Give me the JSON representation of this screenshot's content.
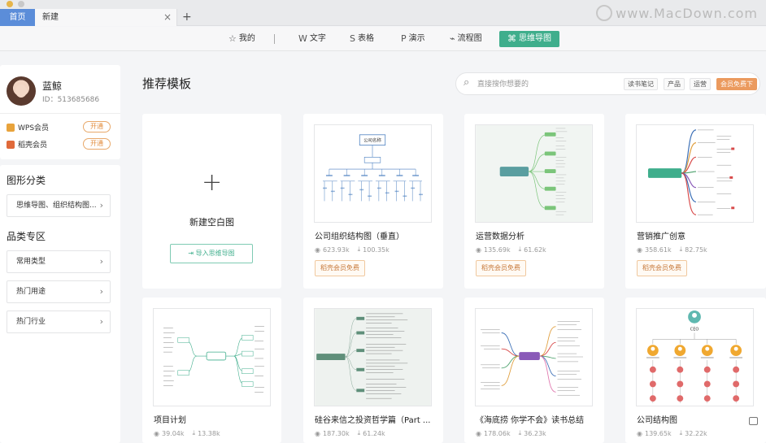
{
  "tabs": {
    "home": "首页",
    "current": "新建",
    "close": "×",
    "plus": "+"
  },
  "watermark": "www.MacDown.com",
  "toolbar": [
    {
      "id": "mine",
      "icon": "☆",
      "label": "我的"
    },
    {
      "id": "text",
      "icon": "W",
      "label": "文字"
    },
    {
      "id": "sheet",
      "icon": "S",
      "label": "表格"
    },
    {
      "id": "slide",
      "icon": "P",
      "label": "演示"
    },
    {
      "id": "flow",
      "icon": "⌁",
      "label": "流程图"
    },
    {
      "id": "mindmap",
      "icon": "⌘",
      "label": "思维导图"
    }
  ],
  "profile": {
    "name": "蓝鲸",
    "id": "ID：513685686",
    "memberships": [
      {
        "label": "WPS会员",
        "action": "开通",
        "color": "#e8a33c"
      },
      {
        "label": "稻壳会员",
        "action": "开通",
        "color": "#e06a3a"
      }
    ]
  },
  "sidebar": {
    "graphic_title": "图形分类",
    "graphic_item": "思维导图、组织结构图...",
    "category_title": "品类专区",
    "category_items": [
      "常用类型",
      "热门用途",
      "热门行业"
    ]
  },
  "main": {
    "title": "推荐模板",
    "search_placeholder": "直接搜你想要的",
    "tags": [
      "读书笔记",
      "产品",
      "运营"
    ],
    "vip_tag": "会员免费下",
    "blank_label": "新建空白图",
    "import_label": "导入思维导图"
  },
  "templates": [
    {
      "name": "公司组织结构图（垂直）",
      "views": "623.93k",
      "downloads": "100.35k",
      "badge": "稻壳会员免费",
      "thumb": "org",
      "center_label": "公司名称"
    },
    {
      "name": "运营数据分析",
      "views": "135.69k",
      "downloads": "61.62k",
      "badge": "稻壳会员免费",
      "thumb": "mindleft"
    },
    {
      "name": "营销推广创意",
      "views": "358.61k",
      "downloads": "82.75k",
      "badge": "稻壳会员免费",
      "thumb": "tree"
    },
    {
      "name": "项目计划",
      "views": "39.04k",
      "downloads": "13.38k",
      "badge": "",
      "thumb": "project"
    },
    {
      "name": "硅谷来信之投资哲学篇（Part ...",
      "views": "187.30k",
      "downloads": "61.24k",
      "badge": "",
      "thumb": "list"
    },
    {
      "name": "《海底捞 你学不会》读书总结",
      "views": "178.06k",
      "downloads": "36.23k",
      "badge": "",
      "thumb": "colorful"
    },
    {
      "name": "公司结构图",
      "views": "139.65k",
      "downloads": "32.22k",
      "badge": "",
      "thumb": "orgicons",
      "center_label": "CEO"
    }
  ],
  "colors": {
    "accent": "#3fae8c",
    "vip": "#eb9a5e",
    "home_tab": "#5b8dd9"
  }
}
